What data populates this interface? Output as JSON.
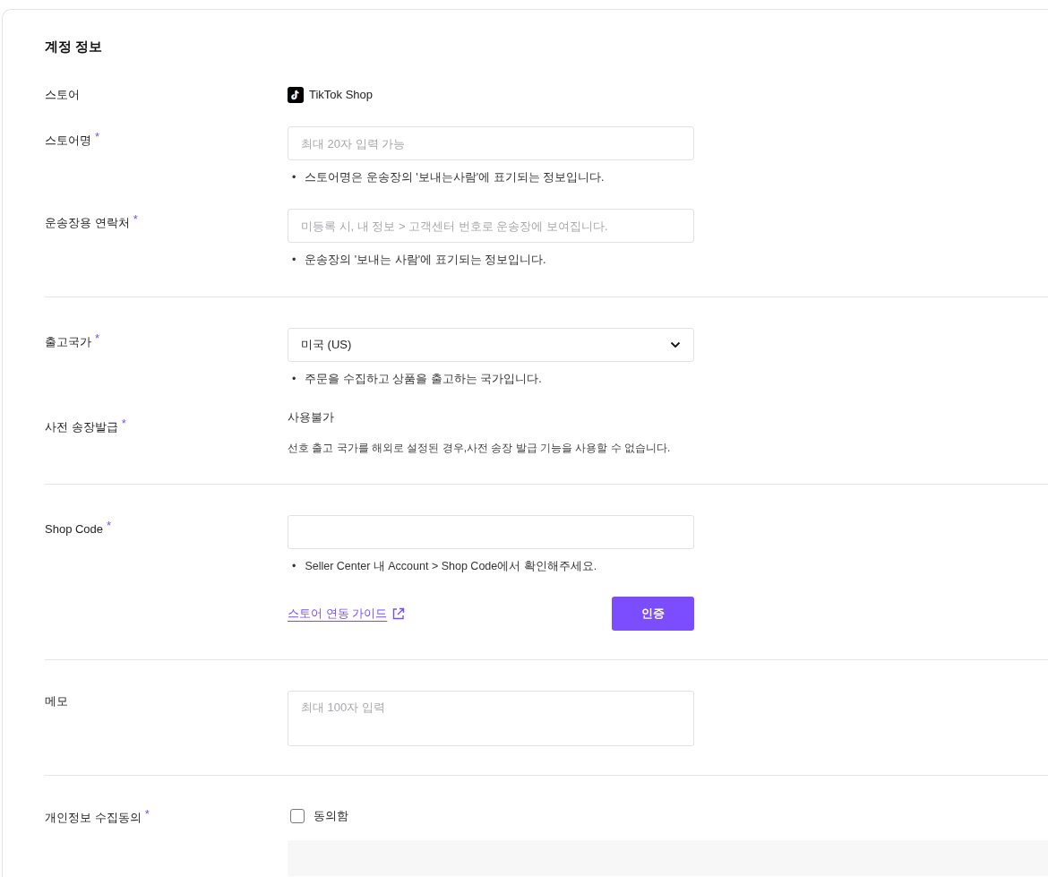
{
  "title": "계정 정보",
  "sections": [
    {
      "rows": [
        {
          "kind": "brand",
          "label": "스토어",
          "value": "TikTok Shop"
        },
        {
          "kind": "input",
          "label": "스토어명",
          "required_mark": "*",
          "placeholder": "최대 20자 입력 가능",
          "hint": {
            "bullet": "•",
            "text": "스토어명은 운송장의 '보내는사람'에 표기되는 정보입니다."
          }
        },
        {
          "kind": "input",
          "label": "운송장용 연락처",
          "required_mark": "*",
          "placeholder": "미등록 시, 내 정보 > 고객센터 번호로 운송장에 보여집니다.",
          "hint": {
            "bullet": "•",
            "text": "운송장의 '보내는 사람'에 표기되는 정보입니다."
          }
        }
      ]
    },
    {
      "rows": [
        {
          "kind": "select",
          "label": "출고국가",
          "required_mark": "*",
          "value": "미국 (US)",
          "hint": {
            "bullet": "•",
            "text": "주문을 수집하고 상품을 출고하는 국가입니다."
          }
        },
        {
          "kind": "static",
          "label": "사전 송장발급",
          "required_mark": "*",
          "value": "사용불가",
          "description": "선호 출고 국가를 해외로 설정된 경우,사전 송장 발급 기능을 사용할 수 없습니다."
        }
      ]
    },
    {
      "rows": [
        {
          "kind": "input",
          "label": "Shop Code",
          "required_mark": "*",
          "placeholder": "",
          "hint": {
            "bullet": "•",
            "text": "Seller Center 내 Account > Shop Code에서 확인해주세요."
          },
          "link": "스토어 연동 가이드",
          "button": "인증"
        }
      ]
    },
    {
      "rows": [
        {
          "kind": "textarea",
          "label": "메모",
          "placeholder": "최대 100자 입력"
        }
      ]
    },
    {
      "rows": [
        {
          "kind": "checkbox",
          "label": "개인정보 수집동의",
          "required_mark": "*",
          "option": "동의함",
          "checked": false
        }
      ]
    }
  ]
}
